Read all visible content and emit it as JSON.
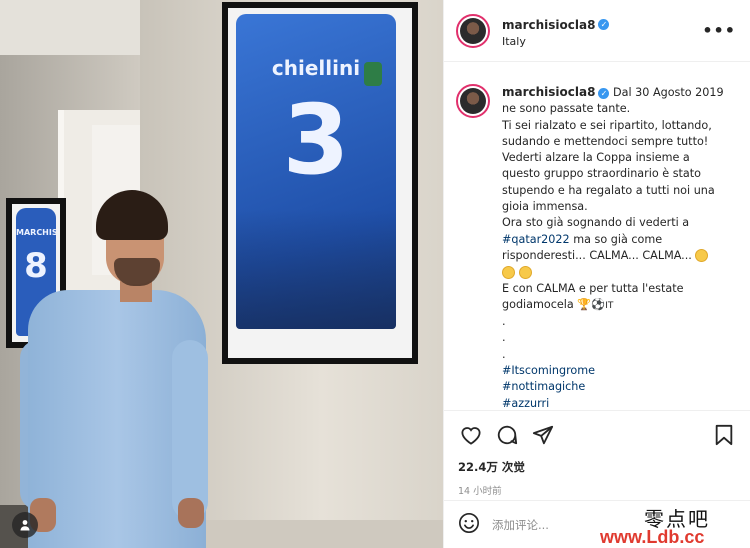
{
  "photo": {
    "jersey_big_name": "chiellini",
    "jersey_big_number": "3",
    "jersey_small_name": "MARCHISIO",
    "jersey_small_number": "8"
  },
  "post_header": {
    "username": "marchisiocla8",
    "location": "Italy",
    "more_icon": "more-horizontal-icon"
  },
  "caption": {
    "username": "marchisiocla8",
    "lines": [
      "Dal 30 Agosto 2019",
      "ne sono passate tante.",
      "Ti sei rialzato e sei ripartito, lottando,",
      "sudando e mettendoci sempre tutto!",
      "Vederti alzare la Coppa insieme a",
      "questo gruppo straordinario è stato",
      "stupendo e ha regalato a tutti noi una",
      "gioia immensa.",
      "Ora sto già sognando di vederti a"
    ],
    "hashtag_qatar": "#qatar2022",
    "after_qatar": " ma so già come",
    "line_risponderesti": "risponderesti... CALMA... CALMA...",
    "line_calma": "E con CALMA e per tutta l'estate",
    "line_godiamocela": "godiamocela",
    "after_emoji": "IT",
    "dots": [
      ".",
      ".",
      "."
    ],
    "hashtags": [
      "#Itscomingrome",
      "#nottimagiche",
      "#azzurri"
    ]
  },
  "actions": {
    "like_icon": "heart-icon",
    "comment_icon": "comment-icon",
    "share_icon": "share-icon",
    "save_icon": "bookmark-icon",
    "views": "22.4万 次觉",
    "time": "14 小时前"
  },
  "comment": {
    "placeholder": "添加评论...",
    "emoji_icon": "emoji-icon"
  },
  "watermark": {
    "main": "零点吧",
    "site": "www.Ldb.cc"
  }
}
